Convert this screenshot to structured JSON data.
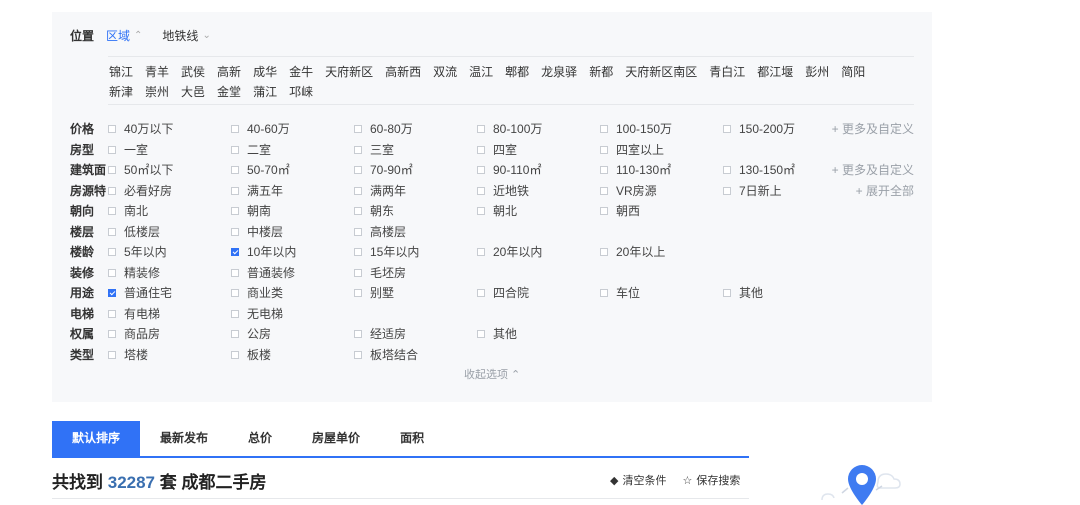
{
  "location": {
    "label": "位置",
    "tabs": [
      {
        "label": "区域",
        "active": true,
        "chevron": "chevron-up-icon"
      },
      {
        "label": "地铁线",
        "active": false,
        "chevron": "chevron-down-icon"
      }
    ],
    "districts": [
      "锦江",
      "青羊",
      "武侯",
      "高新",
      "成华",
      "金牛",
      "天府新区",
      "高新西",
      "双流",
      "温江",
      "郫都",
      "龙泉驿",
      "新都",
      "天府新区南区",
      "青白江",
      "都江堰",
      "彭州",
      "简阳",
      "新津",
      "崇州",
      "大邑",
      "金堂",
      "蒲江",
      "邛崃"
    ]
  },
  "filters": [
    {
      "label": "价格",
      "options": [
        {
          "text": "40万以下"
        },
        {
          "text": "40-60万"
        },
        {
          "text": "60-80万"
        },
        {
          "text": "80-100万"
        },
        {
          "text": "100-150万"
        },
        {
          "text": "150-200万"
        }
      ],
      "more": "+ 更多及自定义"
    },
    {
      "label": "房型",
      "options": [
        {
          "text": "一室"
        },
        {
          "text": "二室"
        },
        {
          "text": "三室"
        },
        {
          "text": "四室"
        },
        {
          "text": "四室以上"
        }
      ]
    },
    {
      "label": "建筑面",
      "options": [
        {
          "text": "50㎡以下"
        },
        {
          "text": "50-70㎡"
        },
        {
          "text": "70-90㎡"
        },
        {
          "text": "90-110㎡"
        },
        {
          "text": "110-130㎡"
        },
        {
          "text": "130-150㎡"
        }
      ],
      "more": "+ 更多及自定义"
    },
    {
      "label": "房源特",
      "options": [
        {
          "text": "必看好房"
        },
        {
          "text": "满五年"
        },
        {
          "text": "满两年"
        },
        {
          "text": "近地铁"
        },
        {
          "text": "VR房源"
        },
        {
          "text": "7日新上"
        }
      ],
      "more": "+ 展开全部"
    },
    {
      "label": "朝向",
      "options": [
        {
          "text": "南北"
        },
        {
          "text": "朝南"
        },
        {
          "text": "朝东"
        },
        {
          "text": "朝北"
        },
        {
          "text": "朝西"
        }
      ]
    },
    {
      "label": "楼层",
      "options": [
        {
          "text": "低楼层"
        },
        {
          "text": "中楼层"
        },
        {
          "text": "高楼层"
        }
      ]
    },
    {
      "label": "楼龄",
      "options": [
        {
          "text": "5年以内"
        },
        {
          "text": "10年以内",
          "checked": true
        },
        {
          "text": "15年以内"
        },
        {
          "text": "20年以内"
        },
        {
          "text": "20年以上"
        }
      ]
    },
    {
      "label": "装修",
      "options": [
        {
          "text": "精装修"
        },
        {
          "text": "普通装修"
        },
        {
          "text": "毛坯房"
        }
      ]
    },
    {
      "label": "用途",
      "options": [
        {
          "text": "普通住宅",
          "checked": true
        },
        {
          "text": "商业类"
        },
        {
          "text": "别墅"
        },
        {
          "text": "四合院"
        },
        {
          "text": "车位"
        },
        {
          "text": "其他"
        }
      ]
    },
    {
      "label": "电梯",
      "options": [
        {
          "text": "有电梯"
        },
        {
          "text": "无电梯"
        }
      ]
    },
    {
      "label": "权属",
      "options": [
        {
          "text": "商品房"
        },
        {
          "text": "公房"
        },
        {
          "text": "经适房"
        },
        {
          "text": "其他"
        }
      ]
    },
    {
      "label": "类型",
      "options": [
        {
          "text": "塔楼"
        },
        {
          "text": "板楼"
        },
        {
          "text": "板塔结合"
        }
      ]
    }
  ],
  "collapse_label": "收起选项 ⌃",
  "sort": {
    "tabs": [
      {
        "label": "默认排序",
        "active": true
      },
      {
        "label": "最新发布"
      },
      {
        "label": "总价"
      },
      {
        "label": "房屋单价"
      },
      {
        "label": "面积"
      }
    ]
  },
  "result": {
    "prefix": "共找到",
    "count": "32287",
    "suffix": "套 成都二手房"
  },
  "actions": {
    "clear": "清空条件",
    "save": "保存搜索"
  },
  "colors": {
    "accent": "#3072f6",
    "panel_bg": "#f7f8fa"
  }
}
